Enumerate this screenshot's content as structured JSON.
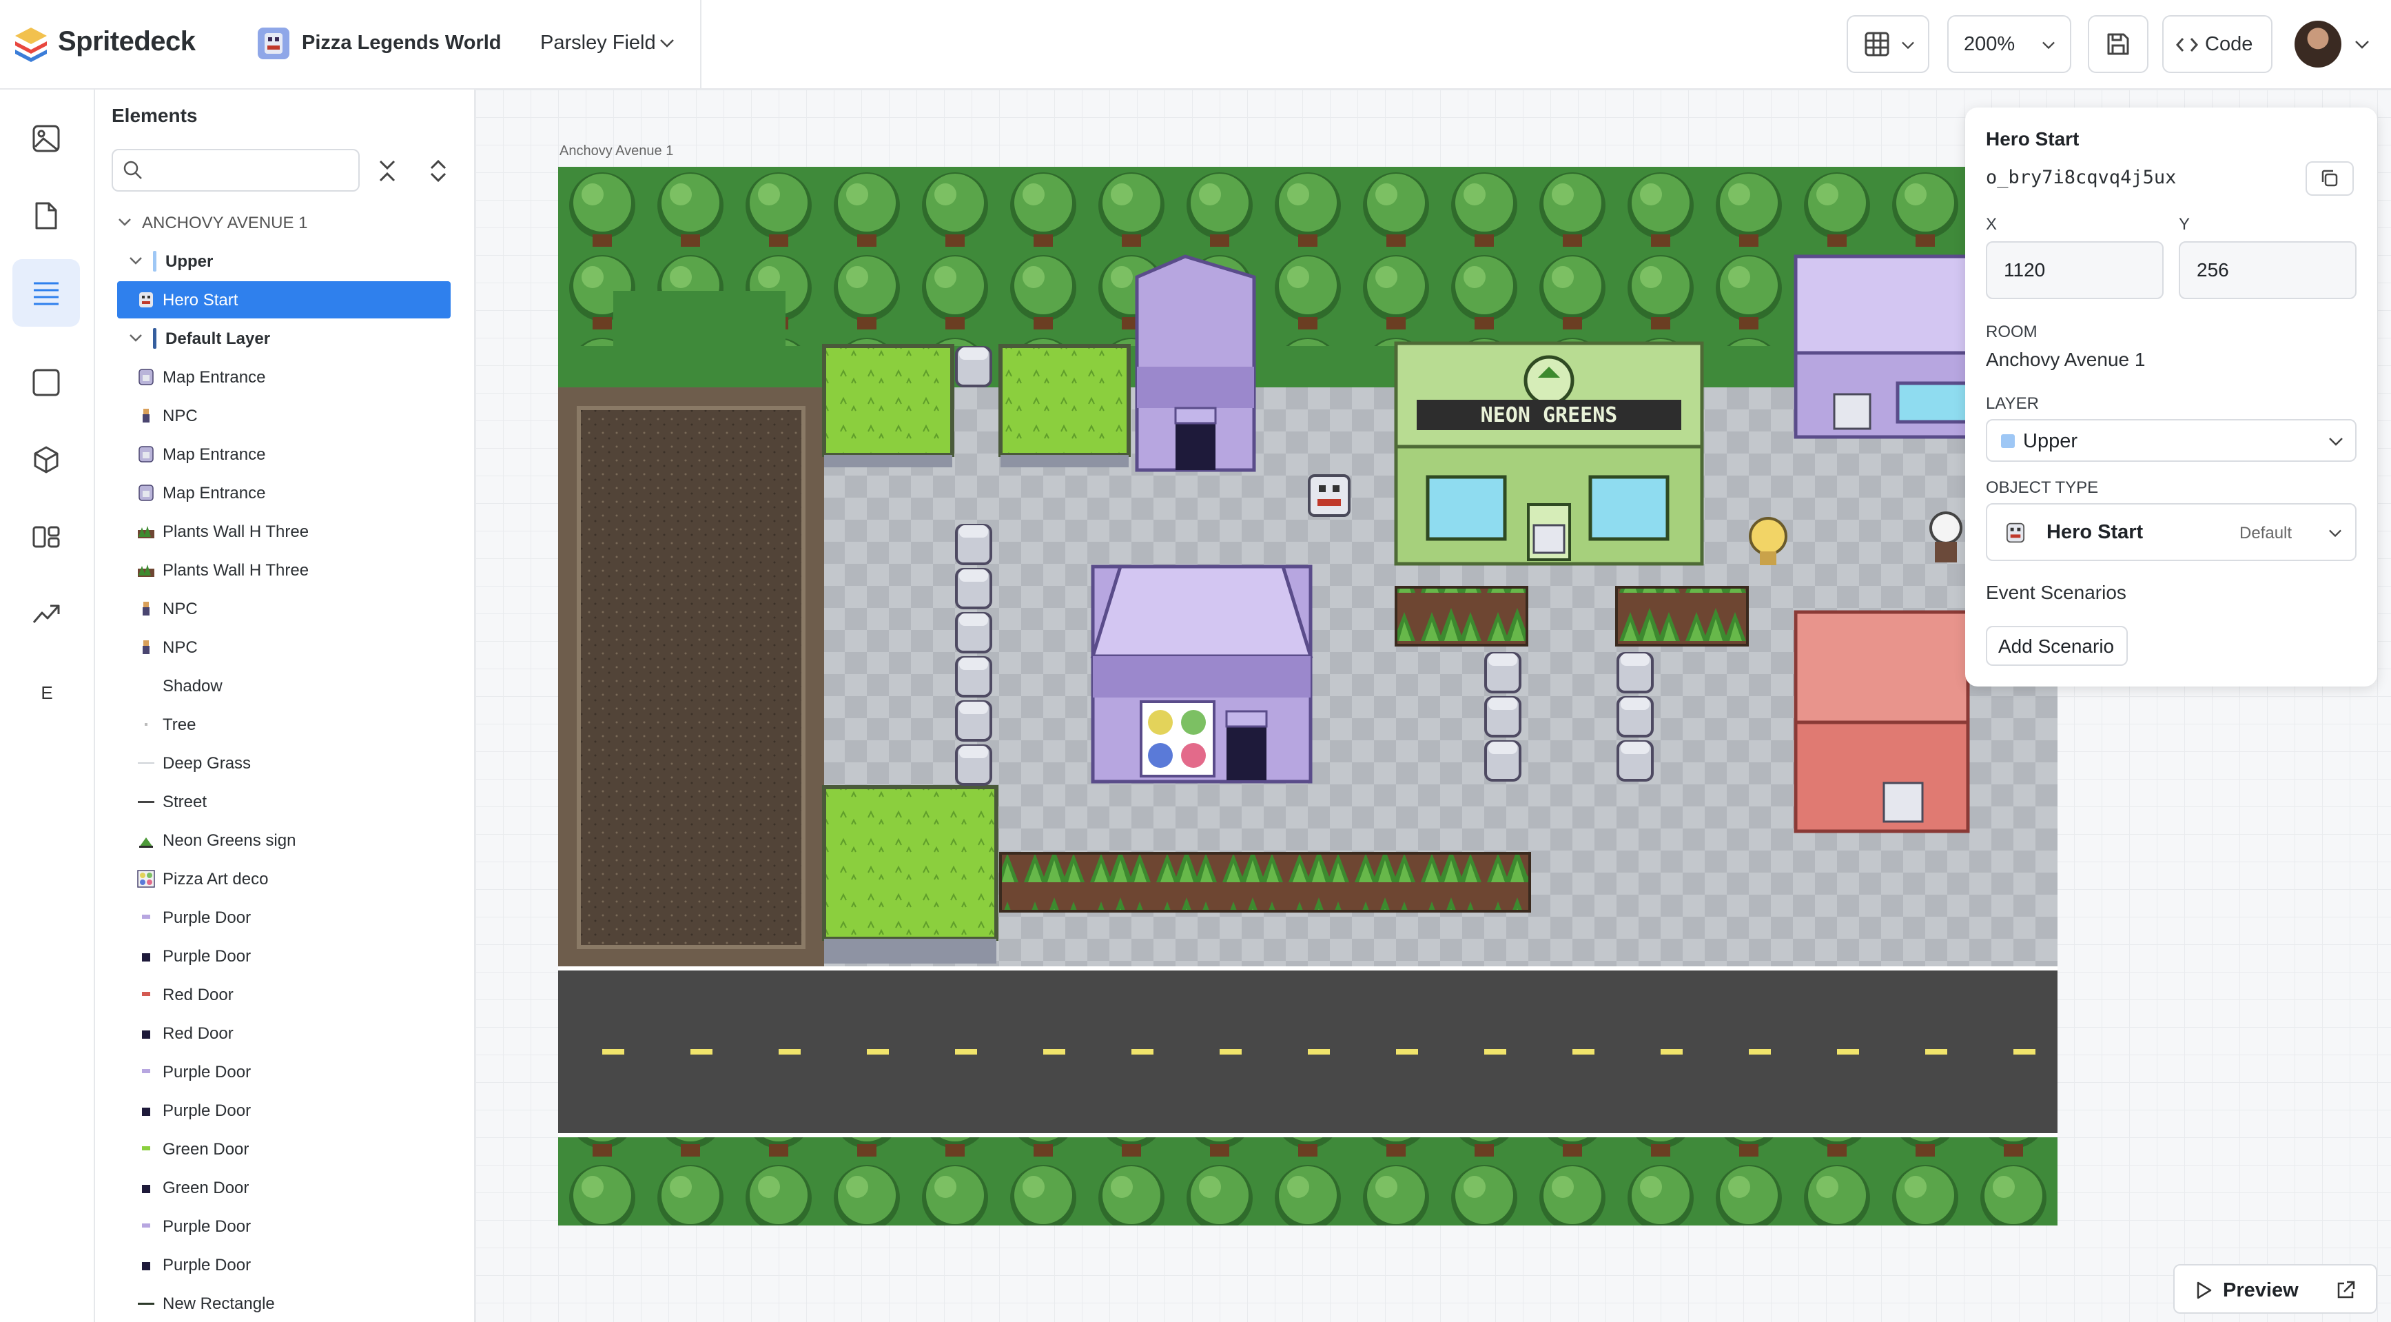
{
  "app": {
    "name": "Spritedeck"
  },
  "project": {
    "name": "Pizza Legends World",
    "room": "Parsley Field"
  },
  "toolbar": {
    "zoom": "200%",
    "code_label": "Code",
    "preview_label": "Preview"
  },
  "rail": {
    "e_label": "E"
  },
  "elements": {
    "title": "Elements",
    "search_placeholder": "",
    "room_heading": "ANCHOVY AVENUE 1",
    "layers": [
      {
        "name": "Upper",
        "color": "#9ec7f5",
        "items": [
          {
            "label": "Hero Start",
            "icon": "hero-icon",
            "selected": true
          }
        ]
      },
      {
        "name": "Default Layer",
        "color": "#355e9e",
        "items": [
          {
            "label": "Map Entrance",
            "icon": "door-icon"
          },
          {
            "label": "NPC",
            "icon": "npc-icon"
          },
          {
            "label": "Map Entrance",
            "icon": "door-icon"
          },
          {
            "label": "Map Entrance",
            "icon": "door-icon"
          },
          {
            "label": "Plants Wall H Three",
            "icon": "plants-icon"
          },
          {
            "label": "Plants Wall H Three",
            "icon": "plants-icon"
          },
          {
            "label": "NPC",
            "icon": "npc-icon"
          },
          {
            "label": "NPC",
            "icon": "npc-icon"
          },
          {
            "label": "Shadow",
            "icon": "blank-icon"
          },
          {
            "label": "Tree",
            "icon": "dot-icon"
          },
          {
            "label": "Deep Grass",
            "icon": "line-light-icon"
          },
          {
            "label": "Street",
            "icon": "line-dark-icon"
          },
          {
            "label": "Neon Greens sign",
            "icon": "sign-icon"
          },
          {
            "label": "Pizza Art deco",
            "icon": "art-icon"
          },
          {
            "label": "Purple Door",
            "icon": "purple-door-icon"
          },
          {
            "label": "Purple Door",
            "icon": "dark-door-icon"
          },
          {
            "label": "Red Door",
            "icon": "red-door-icon"
          },
          {
            "label": "Red Door",
            "icon": "dark-door-icon"
          },
          {
            "label": "Purple Door",
            "icon": "purple-door-icon"
          },
          {
            "label": "Purple Door",
            "icon": "dark-door-icon"
          },
          {
            "label": "Green Door",
            "icon": "green-door-icon"
          },
          {
            "label": "Green Door",
            "icon": "dark-door-icon"
          },
          {
            "label": "Purple Door",
            "icon": "purple-door-icon"
          },
          {
            "label": "Purple Door",
            "icon": "dark-door-icon"
          },
          {
            "label": "New Rectangle",
            "icon": "rect-line-icon"
          }
        ]
      }
    ]
  },
  "map": {
    "caption": "Anchovy Avenue 1",
    "shop_sign": "NEON GREENS"
  },
  "properties": {
    "title": "Hero Start",
    "object_id": "o_bry7i8cqvq4j5ux",
    "x_label": "X",
    "x_value": "1120",
    "y_label": "Y",
    "y_value": "256",
    "room_label": "ROOM",
    "room_value": "Anchovy Avenue 1",
    "layer_label": "LAYER",
    "layer_value": "Upper",
    "object_type_label": "OBJECT TYPE",
    "object_type_value": "Hero Start",
    "object_type_default": "Default",
    "scenarios_label": "Event Scenarios",
    "add_scenario_label": "Add Scenario"
  },
  "colors": {
    "accent": "#2f80ed",
    "selected_row": "#2f80ed",
    "upper_layer": "#9ec7f5"
  }
}
